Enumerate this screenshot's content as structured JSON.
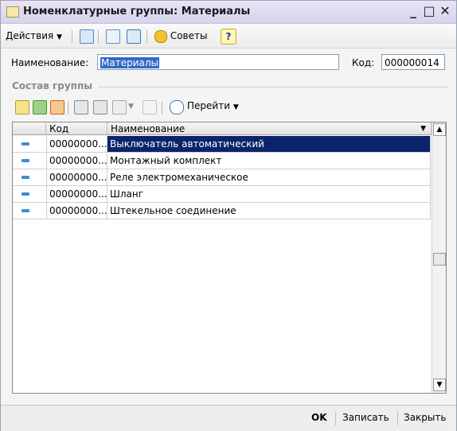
{
  "window": {
    "title": "Номенклатурные группы: Материалы",
    "buttons": {
      "minimize": "_",
      "maximize": "□",
      "close": "✕"
    }
  },
  "toolbar": {
    "actions_label": "Действия",
    "tips_label": "Советы",
    "help_label": "?"
  },
  "form": {
    "name_label": "Наименование:",
    "name_value": "Материалы",
    "code_label": "Код:",
    "code_value": "000000014"
  },
  "group": {
    "title": "Состав группы",
    "goto_label": "Перейти"
  },
  "table": {
    "columns": [
      "Код",
      "Наименование"
    ],
    "rows": [
      {
        "code": "00000000...",
        "name": "Выключатель автоматический",
        "selected": true
      },
      {
        "code": "00000000...",
        "name": "Монтажный комплект",
        "selected": false
      },
      {
        "code": "00000000...",
        "name": "Реле электромеханическое",
        "selected": false
      },
      {
        "code": "00000000...",
        "name": "Шланг",
        "selected": false
      },
      {
        "code": "00000000...",
        "name": "Штекельное соединение",
        "selected": false
      }
    ]
  },
  "footer": {
    "ok_label": "OK",
    "save_label": "Записать",
    "close_label": "Закрыть"
  },
  "colors": {
    "selection": "#0a246a",
    "row_icon": "#3a8ed8"
  }
}
